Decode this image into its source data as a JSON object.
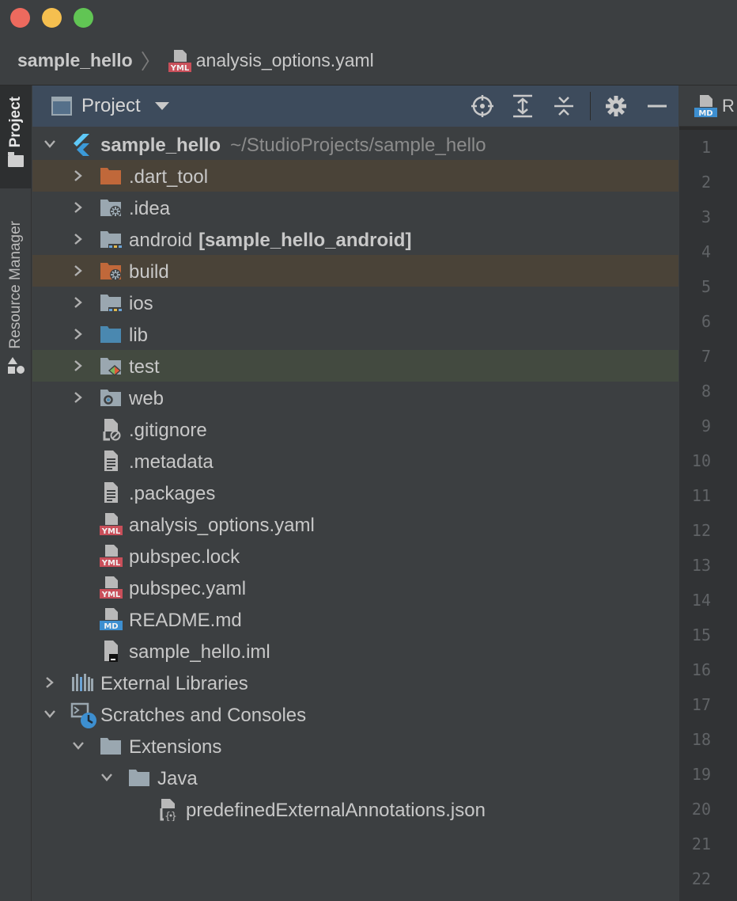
{
  "breadcrumb": {
    "root": "sample_hello",
    "separator": "〉",
    "file_badge": "YML",
    "file": "analysis_options.yaml"
  },
  "toolstrip": {
    "project_label": "Project",
    "resource_label": "Resource Manager"
  },
  "panel": {
    "title": "Project",
    "actions": [
      "locate-icon",
      "expand-all-icon",
      "collapse-all-icon",
      "gear-icon",
      "minimize-icon"
    ]
  },
  "tree": [
    {
      "label": "sample_hello",
      "suffix": "~/StudioProjects/sample_hello",
      "icon": "flutter-icon",
      "depth": 0,
      "state": "open",
      "bold": true
    },
    {
      "label": ".dart_tool",
      "icon": "folder-orange-icon",
      "depth": 1,
      "state": "closed",
      "highlight": "orange"
    },
    {
      "label": ".idea",
      "icon": "folder-settings-icon",
      "depth": 1,
      "state": "closed"
    },
    {
      "label": "android",
      "module": "[sample_hello_android]",
      "icon": "folder-module-icon",
      "depth": 1,
      "state": "closed"
    },
    {
      "label": "build",
      "icon": "folder-orange-settings-icon",
      "depth": 1,
      "state": "closed",
      "highlight": "orange"
    },
    {
      "label": "ios",
      "icon": "folder-module-icon",
      "depth": 1,
      "state": "closed"
    },
    {
      "label": "lib",
      "icon": "folder-blue-icon",
      "depth": 1,
      "state": "closed"
    },
    {
      "label": "test",
      "icon": "folder-test-icon",
      "depth": 1,
      "state": "closed",
      "highlight": "green"
    },
    {
      "label": "web",
      "icon": "folder-web-icon",
      "depth": 1,
      "state": "closed"
    },
    {
      "label": ".gitignore",
      "icon": "file-ignore-icon",
      "depth": 1,
      "state": "none"
    },
    {
      "label": ".metadata",
      "icon": "file-text-icon",
      "depth": 1,
      "state": "none"
    },
    {
      "label": ".packages",
      "icon": "file-text-icon",
      "depth": 1,
      "state": "none"
    },
    {
      "label": "analysis_options.yaml",
      "icon": "file-yml-icon",
      "badge": "YML",
      "depth": 1,
      "state": "none"
    },
    {
      "label": "pubspec.lock",
      "icon": "file-yml-icon",
      "badge": "YML",
      "depth": 1,
      "state": "none"
    },
    {
      "label": "pubspec.yaml",
      "icon": "file-yml-icon",
      "badge": "YML",
      "depth": 1,
      "state": "none"
    },
    {
      "label": "README.md",
      "icon": "file-md-icon",
      "badge": "MD",
      "depth": 1,
      "state": "none"
    },
    {
      "label": "sample_hello.iml",
      "icon": "file-iml-icon",
      "depth": 1,
      "state": "none"
    },
    {
      "label": "External Libraries",
      "icon": "libraries-icon",
      "depth": 0,
      "state": "closed"
    },
    {
      "label": "Scratches and Consoles",
      "icon": "scratches-icon",
      "depth": 0,
      "state": "open"
    },
    {
      "label": "Extensions",
      "icon": "folder-gray-icon",
      "depth": 1,
      "state": "open"
    },
    {
      "label": "Java",
      "icon": "folder-gray-icon",
      "depth": 2,
      "state": "open"
    },
    {
      "label": "predefinedExternalAnnotations.json",
      "icon": "file-json-icon",
      "depth": 3,
      "state": "none"
    }
  ],
  "editor": {
    "tab_badge": "MD",
    "tab_label": "R",
    "line_numbers": [
      "1",
      "2",
      "3",
      "4",
      "5",
      "6",
      "7",
      "8",
      "9",
      "10",
      "11",
      "12",
      "13",
      "14",
      "15",
      "16",
      "17",
      "18",
      "19",
      "20",
      "21",
      "22"
    ]
  },
  "colors": {
    "panel_bg": "#3c3f41",
    "header_bg": "#3d4b5c",
    "highlight_orange": "#4a4338",
    "highlight_green": "#434a40",
    "folder_orange": "#c0683a",
    "folder_blue": "#4a88b0",
    "folder_gray": "#9aa7b0",
    "yml_red": "#c94f5a",
    "md_blue": "#3d8fd0"
  }
}
